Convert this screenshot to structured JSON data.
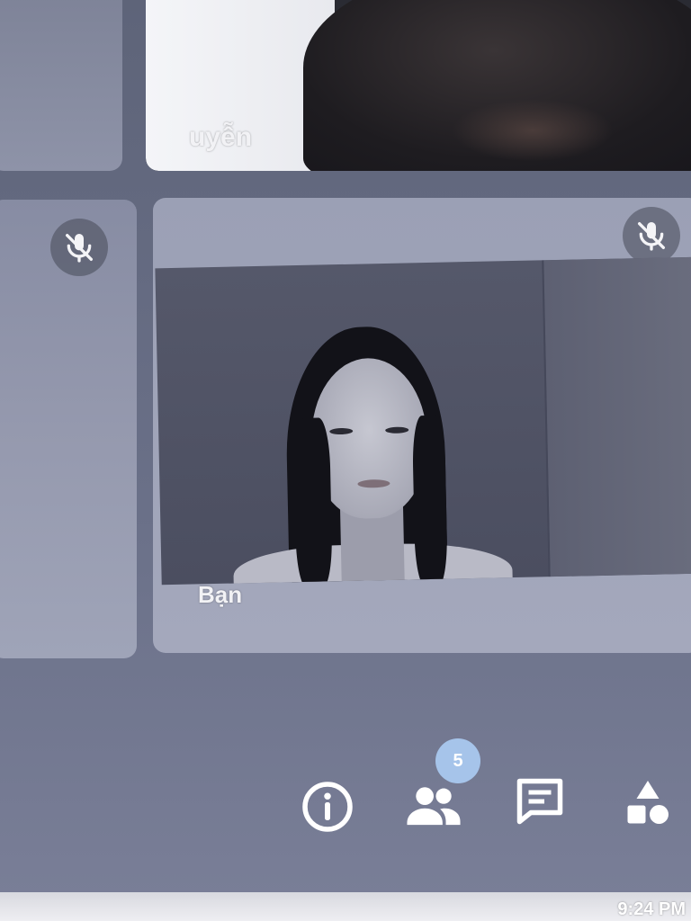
{
  "participants": [
    {
      "name_visible": "uyễn",
      "muted": false
    },
    {
      "name_visible": "",
      "muted": true
    },
    {
      "name_visible": "Bạn",
      "muted": true
    }
  ],
  "toolbar": {
    "people_count": "5",
    "buttons": [
      {
        "icon": "info-icon"
      },
      {
        "icon": "people-icon"
      },
      {
        "icon": "chat-icon"
      },
      {
        "icon": "activities-icon"
      }
    ]
  },
  "clock": "9:24 PM",
  "colors": {
    "background": "#666b82",
    "tile": "#9ba0b5",
    "badge": "#a6c4ea",
    "text": "#f2f2f5"
  }
}
